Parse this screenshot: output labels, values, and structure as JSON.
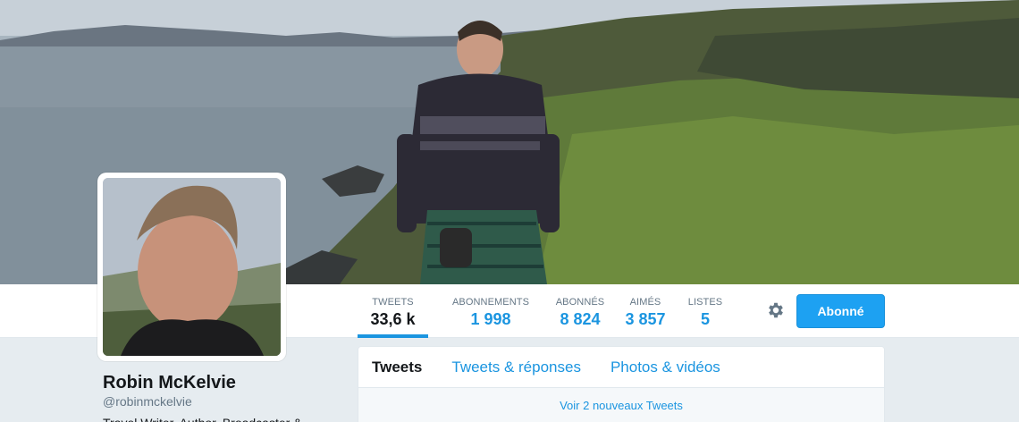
{
  "profile": {
    "name": "Robin McKelvie",
    "handle": "@robinmckelvie",
    "bio": "Travel Writer, Author, Broadcaster &"
  },
  "stats": [
    {
      "label": "TWEETS",
      "value": "33,6 k",
      "active": true
    },
    {
      "label": "ABONNEMENTS",
      "value": "1 998"
    },
    {
      "label": "ABONNÉS",
      "value": "8 824"
    },
    {
      "label": "AIMÉS",
      "value": "3 857"
    },
    {
      "label": "LISTES",
      "value": "5"
    }
  ],
  "actions": {
    "settings_icon": "gear-icon",
    "follow_label": "Abonné"
  },
  "timeline": {
    "tabs": [
      {
        "label": "Tweets",
        "active": true
      },
      {
        "label": "Tweets & réponses"
      },
      {
        "label": "Photos & vidéos"
      }
    ],
    "new_tweets": "Voir 2 nouveaux Tweets"
  },
  "colors": {
    "accent": "#1da1f2",
    "link": "#1b95e0",
    "background": "#e6ecf0"
  }
}
